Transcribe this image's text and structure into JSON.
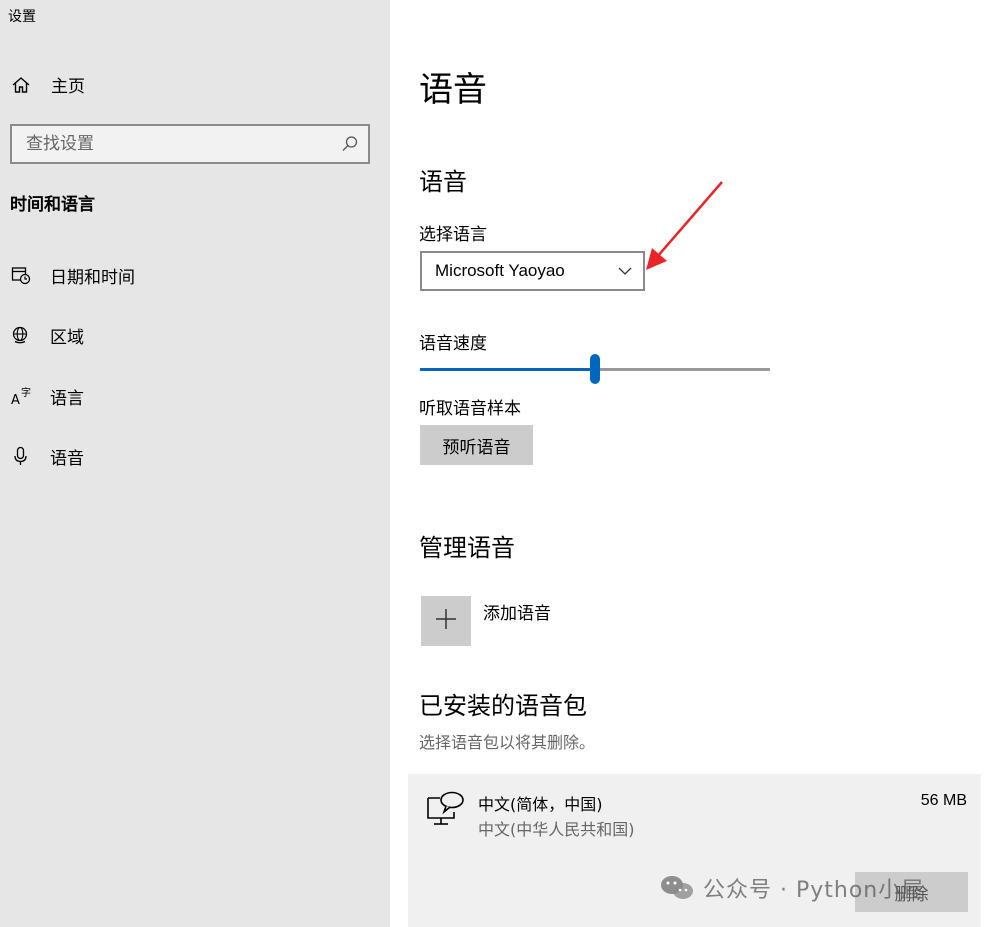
{
  "app": {
    "title": "设置"
  },
  "sidebar": {
    "home_label": "主页",
    "search_placeholder": "查找设置",
    "section_title": "时间和语言",
    "items": [
      {
        "label": "日期和时间",
        "icon": "calendar-clock-icon"
      },
      {
        "label": "区域",
        "icon": "globe-icon"
      },
      {
        "label": "语言",
        "icon": "language-icon"
      },
      {
        "label": "语音",
        "icon": "microphone-icon"
      }
    ]
  },
  "main": {
    "page_title": "语音",
    "voice_section": {
      "title": "语音",
      "select_label": "选择语言",
      "selected_voice": "Microsoft Yaoyao",
      "speed_label": "语音速度",
      "speed_fraction": 0.5,
      "sample_label": "听取语音样本",
      "preview_button": "预听语音"
    },
    "manage_section": {
      "title": "管理语音",
      "add_label": "添加语音"
    },
    "installed_section": {
      "title": "已安装的语音包",
      "hint": "选择语音包以将其删除。",
      "packs": [
        {
          "name": "中文(简体，中国)",
          "sub": "中文(中华人民共和国)",
          "size": "56 MB",
          "delete_label": "删除"
        }
      ]
    }
  },
  "watermark": {
    "text": "公众号 · Python小屋"
  },
  "colors": {
    "accent": "#0067c0",
    "sidebar_bg": "#e6e6e6",
    "annotation_arrow": "#e8262a"
  }
}
